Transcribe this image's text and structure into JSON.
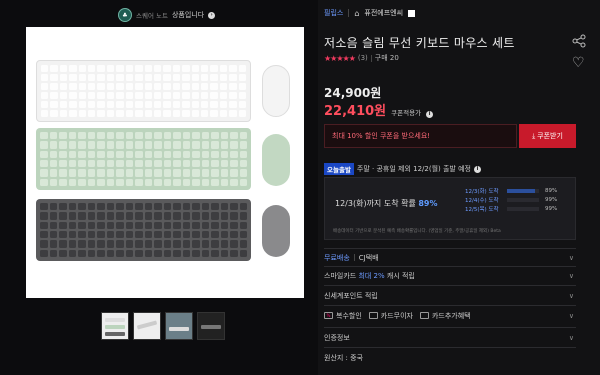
{
  "seller": {
    "logo_text": "♣",
    "name": "스퀘어 노트",
    "label": "상품입니다"
  },
  "breadcrumb": {
    "category": "필립스",
    "brand": "퓨전에프엔씨"
  },
  "product": {
    "title": "저소음 슬림 무선 키보드 마우스 세트",
    "stars": "★★★★★",
    "review_count": "(3)",
    "sold": "구매 20",
    "price_original": "24,900원",
    "price_sale": "22,410원",
    "price_sale_label": "쿠폰적용가"
  },
  "coupon": {
    "text": "최대 10% 할인 쿠폰을 받으세요!",
    "button": "쿠폰받기"
  },
  "delivery": {
    "badge": "오늘출발",
    "text": "주말 · 공휴일 제외 12/2(월) 출발 예정",
    "main_prefix": "12/3(화)까지 도착 확률",
    "main_pct": "89%",
    "rows": [
      {
        "day": "12/3(화) 도착",
        "pct": "89%",
        "fill": 0.89
      },
      {
        "day": "12/4(수) 도착",
        "pct": "99%",
        "fill": 0.99
      },
      {
        "day": "12/5(목) 도착",
        "pct": "99%",
        "fill": 0.99
      }
    ],
    "note": "배송데이터 기반으로 분석된 예측 배송확률입니다. (영업일 기준, 주말/공휴일 제외) Beta"
  },
  "info": {
    "shipping_free": "무료배송",
    "shipping_carrier": "CJ택배",
    "smile_prefix": "스마일카드",
    "smile_hl": "최대 2%",
    "smile_suffix": "캐시 적립",
    "shinsegae": "신세계포인트 적립",
    "chips": [
      "복수할인",
      "카드무이자",
      "카드추가혜택"
    ],
    "cert": "인증정보",
    "origin": "원산지 : 중국"
  }
}
